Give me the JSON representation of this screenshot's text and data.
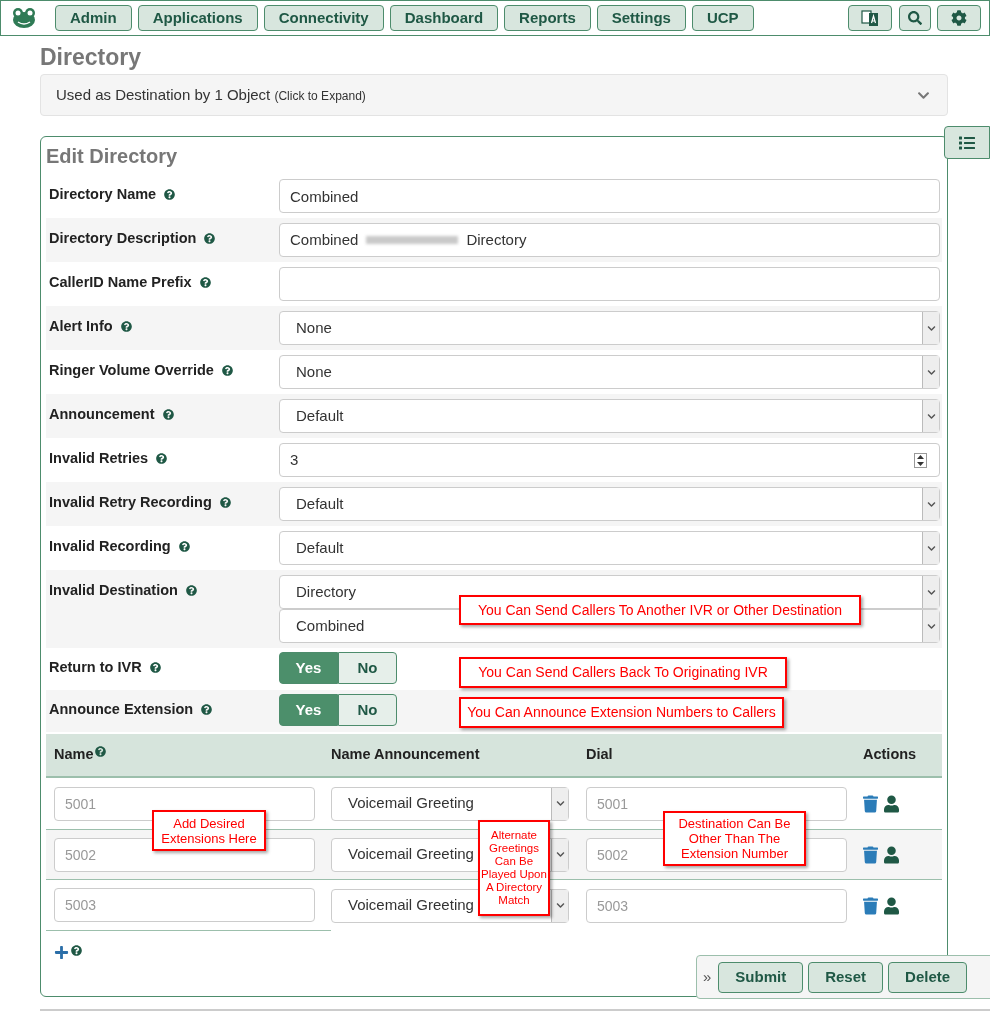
{
  "nav": {
    "items": [
      "Admin",
      "Applications",
      "Connectivity",
      "Dashboard",
      "Reports",
      "Settings",
      "UCP"
    ]
  },
  "page_title": "Directory",
  "destination_bar": {
    "text": "Used as Destination by 1 Object",
    "hint": "(Click to Expand)"
  },
  "form": {
    "title": "Edit Directory",
    "fields": [
      {
        "label": "Directory Name",
        "kind": "text",
        "value": "Combined"
      },
      {
        "label": "Directory Description",
        "kind": "redacted",
        "values": [
          "Combined",
          "Directory"
        ]
      },
      {
        "label": "CallerID Name Prefix",
        "kind": "text"
      },
      {
        "label": "Alert Info",
        "kind": "select",
        "value": "None"
      },
      {
        "label": "Ringer Volume Override",
        "kind": "select",
        "value": "None"
      },
      {
        "label": "Announcement",
        "kind": "select",
        "value": "Default"
      },
      {
        "label": "Invalid Retries",
        "kind": "number",
        "value": "3"
      },
      {
        "label": "Invalid Retry Recording",
        "kind": "select",
        "value": "Default"
      },
      {
        "label": "Invalid Recording",
        "kind": "select",
        "value": "Default"
      },
      {
        "label": "Invalid Destination",
        "kind": "double",
        "values": [
          "Directory",
          "Combined"
        ]
      },
      {
        "label": "Return to IVR",
        "kind": "toggle",
        "options": [
          {
            "label": "Yes",
            "selected": true
          },
          {
            "label": "No",
            "selected": false
          }
        ]
      },
      {
        "label": "Announce Extension",
        "kind": "toggle",
        "options": [
          {
            "label": "Yes",
            "selected": true
          },
          {
            "label": "No",
            "selected": false
          }
        ]
      }
    ]
  },
  "table": {
    "columns": [
      "Name",
      "Name Announcement",
      "Dial",
      "Actions"
    ],
    "rows": [
      {
        "name_placeholder": "5001",
        "announcement": "Voicemail Greeting",
        "dial_placeholder": "5001"
      },
      {
        "name_placeholder": "5002",
        "announcement": "Voicemail Greeting",
        "dial_placeholder": "5002"
      },
      {
        "name_placeholder": "5003",
        "announcement": "Voicemail Greeting",
        "dial_placeholder": "5003"
      }
    ]
  },
  "annotations": [
    {
      "text": "You Can Send Callers To Another IVR or Other Destination"
    },
    {
      "text": "You Can Send Callers Back To Originating IVR"
    },
    {
      "text": "You Can Announce Extension Numbers to Callers"
    },
    {
      "text": "Add Desired Extensions Here"
    },
    {
      "text": "Alternate Greetings Can Be Played Upon A Directory Match"
    },
    {
      "text": "Destination Can Be Other Than The Extension Number"
    }
  ],
  "action_bar": {
    "expander": "»"
  },
  "buttons": [
    "Submit",
    "Reset",
    "Delete"
  ]
}
